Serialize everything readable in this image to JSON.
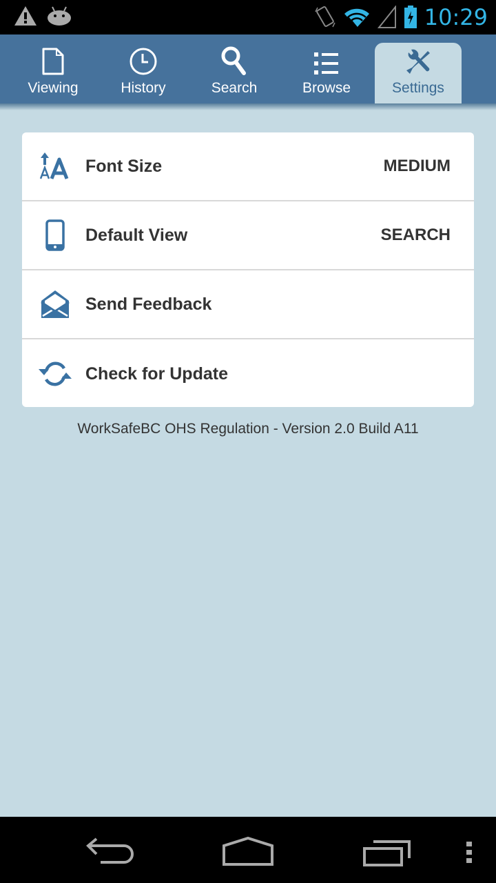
{
  "status_bar": {
    "time": "10:29",
    "left_icons": [
      "warning-icon",
      "android-debug-icon"
    ],
    "right_icons": [
      "vibrate-icon",
      "wifi-icon",
      "cell-signal-icon",
      "battery-charging-icon"
    ],
    "accent_color": "#33b5e5"
  },
  "tabs": [
    {
      "label": "Viewing",
      "icon": "document-icon",
      "active": false
    },
    {
      "label": "History",
      "icon": "clock-icon",
      "active": false
    },
    {
      "label": "Search",
      "icon": "search-icon",
      "active": false
    },
    {
      "label": "Browse",
      "icon": "list-icon",
      "active": false
    },
    {
      "label": "Settings",
      "icon": "wrench-screwdriver-icon",
      "active": true
    }
  ],
  "settings": {
    "items": [
      {
        "label": "Font Size",
        "value": "MEDIUM",
        "icon": "font-size-icon"
      },
      {
        "label": "Default View",
        "value": "SEARCH",
        "icon": "phone-icon"
      },
      {
        "label": "Send Feedback",
        "value": "",
        "icon": "envelope-icon"
      },
      {
        "label": "Check for Update",
        "value": "",
        "icon": "refresh-icon"
      }
    ]
  },
  "footer": {
    "version_text": "WorkSafeBC OHS Regulation - Version 2.0 Build A11"
  },
  "nav_bar": {
    "buttons": [
      "back",
      "home",
      "recent-apps",
      "menu"
    ]
  },
  "colors": {
    "tab_bar": "#46729c",
    "background": "#c5dae3",
    "icon_blue": "#3a72a3"
  }
}
